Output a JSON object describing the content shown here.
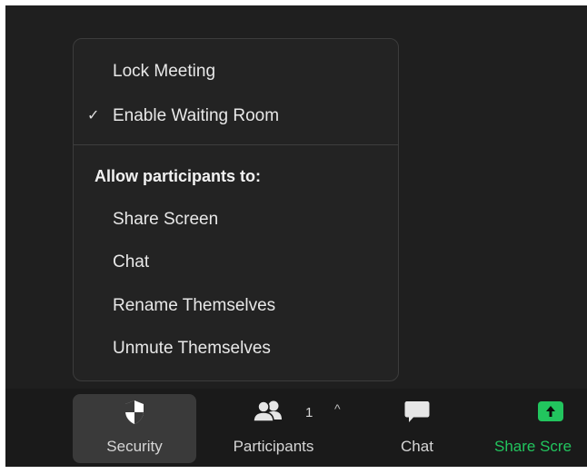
{
  "menu": {
    "items": [
      {
        "label": "Lock Meeting",
        "checked": false
      },
      {
        "label": "Enable Waiting Room",
        "checked": true
      }
    ],
    "heading": "Allow participants to:",
    "permissions": [
      {
        "label": "Share Screen"
      },
      {
        "label": "Chat"
      },
      {
        "label": "Rename Themselves"
      },
      {
        "label": "Unmute Themselves"
      }
    ],
    "check_glyph": "✓"
  },
  "toolbar": {
    "security_label": "Security",
    "participants_label": "Participants",
    "participants_count": "1",
    "participants_caret": "^",
    "chat_label": "Chat",
    "share_label": "Share Scre"
  },
  "colors": {
    "meeting_bg": "#1f1f1f",
    "toolbar_bg": "#1a1a1a",
    "menu_bg": "#232323",
    "share_accent": "#22c55e"
  },
  "icons": {
    "security": "shield-icon",
    "participants": "people-icon",
    "chat": "chat-bubble-icon",
    "share": "share-screen-arrow-icon"
  }
}
